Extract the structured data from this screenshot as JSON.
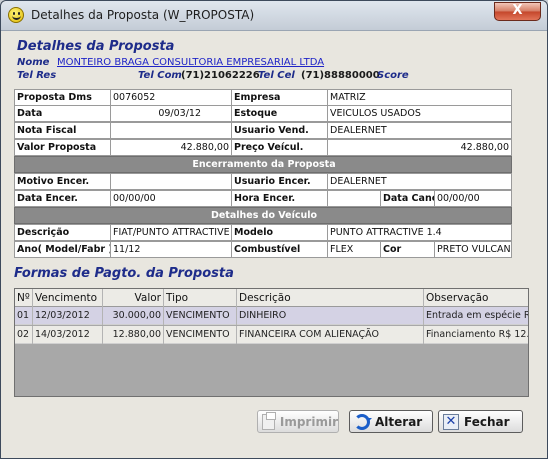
{
  "window": {
    "title": "Detalhes da Proposta (W_PROPOSTA)",
    "close_label": "X"
  },
  "header": {
    "title": "Detalhes da Proposta",
    "nome_label": "Nome",
    "nome_value": "MONTEIRO BRAGA CONSULTORIA EMPRESARIAL LTDA",
    "telres_label": "Tel Res",
    "telcom_label": "Tel Com",
    "telcom_value": "(71)21062226",
    "telcel_label": "Tel Cel",
    "telcel_value": "(71)88880000",
    "score_label": "Score"
  },
  "proposta": {
    "dms_label": "Proposta Dms",
    "dms_value": "0076052",
    "empresa_label": "Empresa",
    "empresa_value": "MATRIZ",
    "data_label": "Data",
    "data_value": "09/03/12",
    "estoque_label": "Estoque",
    "estoque_value": "VEICULOS USADOS",
    "nf_label": "Nota Fiscal",
    "nf_value": "",
    "usuario_label": "Usuario Vend.",
    "usuario_value": "DEALERNET",
    "valor_label": "Valor Proposta",
    "valor_value": "42.880,00",
    "preco_label": "Preço Veícul.",
    "preco_value": "42.880,00"
  },
  "encerramento": {
    "section_title": "Encerramento da Proposta",
    "motivo_label": "Motivo Encer.",
    "motivo_value": "",
    "usuario_label": "Usuario Encer.",
    "usuario_value": "DEALERNET",
    "data_label": "Data Encer.",
    "data_value": "00/00/00",
    "hora_label": "Hora Encer.",
    "hora_value": "",
    "canc_label": "Data Canc.",
    "canc_value": "00/00/00"
  },
  "veiculo": {
    "section_title": "Detalhes do Veículo",
    "descricao_label": "Descrição",
    "descricao_value": "FIAT/PUNTO ATTRACTIVE",
    "modelo_label": "Modelo",
    "modelo_value": "PUNTO ATTRACTIVE 1.4",
    "ano_label": "Ano( Model/Fabr )",
    "ano_value": "11/12",
    "combustivel_label": "Combustível",
    "combustivel_value": "FLEX",
    "cor_label": "Cor",
    "cor_value": "PRETO VULCANO"
  },
  "pagamento": {
    "title": "Formas de Pagto. da Proposta",
    "columns": [
      "Nº",
      "Vencimento",
      "Valor",
      "Tipo",
      "Descrição",
      "Observação"
    ],
    "rows": [
      [
        "01",
        "12/03/2012",
        "30.000,00",
        "VENCIMENTO",
        "DINHEIRO",
        "Entrada em espécie R"
      ],
      [
        "02",
        "14/03/2012",
        "12.880,00",
        "VENCIMENTO",
        "FINANCEIRA COM ALIENAÇÃO",
        "Financiamento R$ 12."
      ]
    ]
  },
  "buttons": {
    "imprimir": "Imprimir",
    "alterar": "Alterar",
    "fechar": "Fechar"
  }
}
